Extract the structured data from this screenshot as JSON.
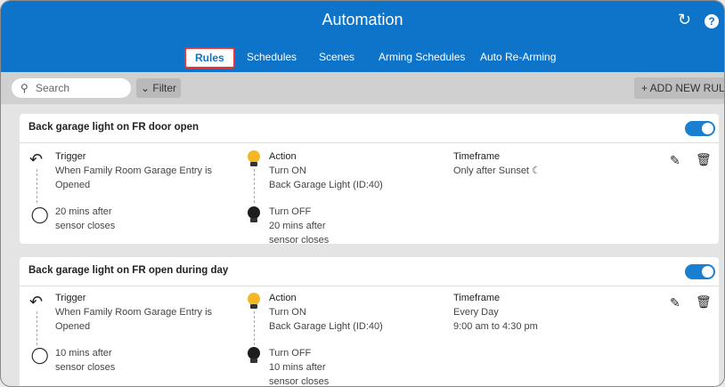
{
  "header": {
    "title": "Automation",
    "refresh_icon": "refresh-icon",
    "help_label": "?",
    "tabs": [
      {
        "label": "Rules",
        "active": true
      },
      {
        "label": "Schedules"
      },
      {
        "label": "Scenes"
      },
      {
        "label": "Arming Schedules"
      },
      {
        "label": "Auto Re-Arming"
      }
    ]
  },
  "toolbar": {
    "search_placeholder": "Search",
    "filter_label": "Filter",
    "add_label": "+ ADD NEW RULE"
  },
  "rules": [
    {
      "title": "Back garage light on FR door open",
      "enabled": true,
      "trigger_label": "Trigger",
      "trigger_line1": "When Family Room Garage Entry is",
      "trigger_line2": "Opened",
      "trigger_end_line1": "20 mins after",
      "trigger_end_line2": "sensor closes",
      "action_label": "Action",
      "action_on": "Turn ON",
      "action_device": "Back Garage Light (ID:40)",
      "action_off": "Turn OFF",
      "action_off_line1": "20 mins after",
      "action_off_line2": "sensor closes",
      "timeframe_label": "Timeframe",
      "timeframe_line1": "Only after Sunset",
      "timeframe_line2": ""
    },
    {
      "title": "Back garage light on FR open during day",
      "enabled": true,
      "trigger_label": "Trigger",
      "trigger_line1": "When Family Room Garage Entry is",
      "trigger_line2": "Opened",
      "trigger_end_line1": "10 mins after",
      "trigger_end_line2": "sensor closes",
      "action_label": "Action",
      "action_on": "Turn ON",
      "action_device": "Back Garage Light (ID:40)",
      "action_off": "Turn OFF",
      "action_off_line1": "10 mins after",
      "action_off_line2": "sensor closes",
      "timeframe_label": "Timeframe",
      "timeframe_line1": "Every Day",
      "timeframe_line2": "9:00 am to 4:30 pm"
    }
  ]
}
